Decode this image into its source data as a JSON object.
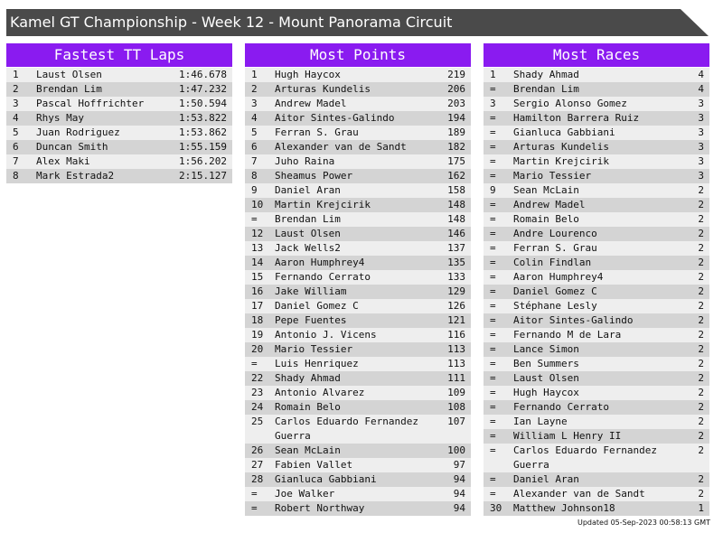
{
  "title": "Kamel GT Championship - Week 12 - Mount Panorama Circuit",
  "footer": "Updated 05-Sep-2023 00:58:13 GMT",
  "colors": {
    "header": "#8a1bf0",
    "titlebar": "#4a4a4a"
  },
  "panels": [
    {
      "title": "Fastest TT Laps",
      "rows": [
        {
          "pos": "1",
          "name": "Laust Olsen",
          "value": "1:46.678"
        },
        {
          "pos": "2",
          "name": "Brendan Lim",
          "value": "1:47.232"
        },
        {
          "pos": "3",
          "name": "Pascal Hoffrichter",
          "value": "1:50.594"
        },
        {
          "pos": "4",
          "name": "Rhys May",
          "value": "1:53.822"
        },
        {
          "pos": "5",
          "name": "Juan Rodriguez",
          "value": "1:53.862"
        },
        {
          "pos": "6",
          "name": "Duncan Smith",
          "value": "1:55.159"
        },
        {
          "pos": "7",
          "name": "Alex Maki",
          "value": "1:56.202"
        },
        {
          "pos": "8",
          "name": "Mark Estrada2",
          "value": "2:15.127"
        }
      ]
    },
    {
      "title": "Most Points",
      "rows": [
        {
          "pos": "1",
          "name": "Hugh Haycox",
          "value": "219"
        },
        {
          "pos": "2",
          "name": "Arturas Kundelis",
          "value": "206"
        },
        {
          "pos": "3",
          "name": "Andrew Madel",
          "value": "203"
        },
        {
          "pos": "4",
          "name": "Aitor Sintes-Galindo",
          "value": "194"
        },
        {
          "pos": "5",
          "name": "Ferran S. Grau",
          "value": "189"
        },
        {
          "pos": "6",
          "name": "Alexander van de Sandt",
          "value": "182"
        },
        {
          "pos": "7",
          "name": "Juho Raina",
          "value": "175"
        },
        {
          "pos": "8",
          "name": "Sheamus Power",
          "value": "162"
        },
        {
          "pos": "9",
          "name": "Daniel Aran",
          "value": "158"
        },
        {
          "pos": "10",
          "name": "Martin Krejcirik",
          "value": "148"
        },
        {
          "pos": "=",
          "name": "Brendan Lim",
          "value": "148"
        },
        {
          "pos": "12",
          "name": "Laust Olsen",
          "value": "146"
        },
        {
          "pos": "13",
          "name": "Jack Wells2",
          "value": "137"
        },
        {
          "pos": "14",
          "name": "Aaron Humphrey4",
          "value": "135"
        },
        {
          "pos": "15",
          "name": "Fernando Cerrato",
          "value": "133"
        },
        {
          "pos": "16",
          "name": "Jake William",
          "value": "129"
        },
        {
          "pos": "17",
          "name": "Daniel Gomez C",
          "value": "126"
        },
        {
          "pos": "18",
          "name": "Pepe Fuentes",
          "value": "121"
        },
        {
          "pos": "19",
          "name": "Antonio J. Vicens",
          "value": "116"
        },
        {
          "pos": "20",
          "name": "Mario Tessier",
          "value": "113"
        },
        {
          "pos": "=",
          "name": "Luis Henriquez",
          "value": "113"
        },
        {
          "pos": "22",
          "name": "Shady Ahmad",
          "value": "111"
        },
        {
          "pos": "23",
          "name": "Antonio Alvarez",
          "value": "109"
        },
        {
          "pos": "24",
          "name": "Romain Belo",
          "value": "108"
        },
        {
          "pos": "25",
          "name": "Carlos Eduardo Fernandez Guerra",
          "value": "107"
        },
        {
          "pos": "26",
          "name": "Sean McLain",
          "value": "100"
        },
        {
          "pos": "27",
          "name": "Fabien Vallet",
          "value": "97"
        },
        {
          "pos": "28",
          "name": "Gianluca Gabbiani",
          "value": "94"
        },
        {
          "pos": "=",
          "name": "Joe Walker",
          "value": "94"
        },
        {
          "pos": "=",
          "name": "Robert Northway",
          "value": "94"
        }
      ]
    },
    {
      "title": "Most Races",
      "rows": [
        {
          "pos": "1",
          "name": "Shady Ahmad",
          "value": "4"
        },
        {
          "pos": "=",
          "name": "Brendan Lim",
          "value": "4"
        },
        {
          "pos": "3",
          "name": "Sergio Alonso Gomez",
          "value": "3"
        },
        {
          "pos": "=",
          "name": "Hamilton Barrera Ruiz",
          "value": "3"
        },
        {
          "pos": "=",
          "name": "Gianluca Gabbiani",
          "value": "3"
        },
        {
          "pos": "=",
          "name": "Arturas Kundelis",
          "value": "3"
        },
        {
          "pos": "=",
          "name": "Martin Krejcirik",
          "value": "3"
        },
        {
          "pos": "=",
          "name": "Mario Tessier",
          "value": "3"
        },
        {
          "pos": "9",
          "name": "Sean McLain",
          "value": "2"
        },
        {
          "pos": "=",
          "name": "Andrew Madel",
          "value": "2"
        },
        {
          "pos": "=",
          "name": "Romain Belo",
          "value": "2"
        },
        {
          "pos": "=",
          "name": "Andre Lourenco",
          "value": "2"
        },
        {
          "pos": "=",
          "name": "Ferran S. Grau",
          "value": "2"
        },
        {
          "pos": "=",
          "name": "Colin Findlan",
          "value": "2"
        },
        {
          "pos": "=",
          "name": "Aaron Humphrey4",
          "value": "2"
        },
        {
          "pos": "=",
          "name": "Daniel Gomez C",
          "value": "2"
        },
        {
          "pos": "=",
          "name": "Stéphane Lesly",
          "value": "2"
        },
        {
          "pos": "=",
          "name": "Aitor Sintes-Galindo",
          "value": "2"
        },
        {
          "pos": "=",
          "name": "Fernando M de Lara",
          "value": "2"
        },
        {
          "pos": "=",
          "name": "Lance Simon",
          "value": "2"
        },
        {
          "pos": "=",
          "name": "Ben Summers",
          "value": "2"
        },
        {
          "pos": "=",
          "name": "Laust Olsen",
          "value": "2"
        },
        {
          "pos": "=",
          "name": "Hugh Haycox",
          "value": "2"
        },
        {
          "pos": "=",
          "name": "Fernando Cerrato",
          "value": "2"
        },
        {
          "pos": "=",
          "name": "Ian Layne",
          "value": "2"
        },
        {
          "pos": "=",
          "name": "William L Henry II",
          "value": "2"
        },
        {
          "pos": "=",
          "name": "Carlos Eduardo Fernandez Guerra",
          "value": "2"
        },
        {
          "pos": "=",
          "name": "Daniel Aran",
          "value": "2"
        },
        {
          "pos": "=",
          "name": "Alexander van de Sandt",
          "value": "2"
        },
        {
          "pos": "30",
          "name": "Matthew Johnson18",
          "value": "1"
        }
      ]
    }
  ]
}
